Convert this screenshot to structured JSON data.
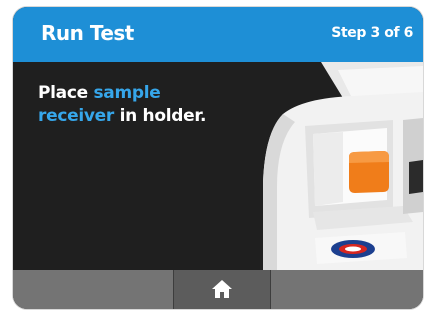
{
  "header": {
    "title": "Run Test",
    "step": "Step 3 of 6"
  },
  "instruction": {
    "part1": "Place ",
    "highlight1": "sample receiver",
    "part2": " in holder."
  },
  "footer": {
    "home_icon": "home-icon"
  },
  "colors": {
    "header_bg": "#1e8fd6",
    "highlight_text": "#36a6ea",
    "screen_bg": "#1f1f1f",
    "footer_bg": "#747474",
    "orange_receiver": "#f07d1a"
  }
}
